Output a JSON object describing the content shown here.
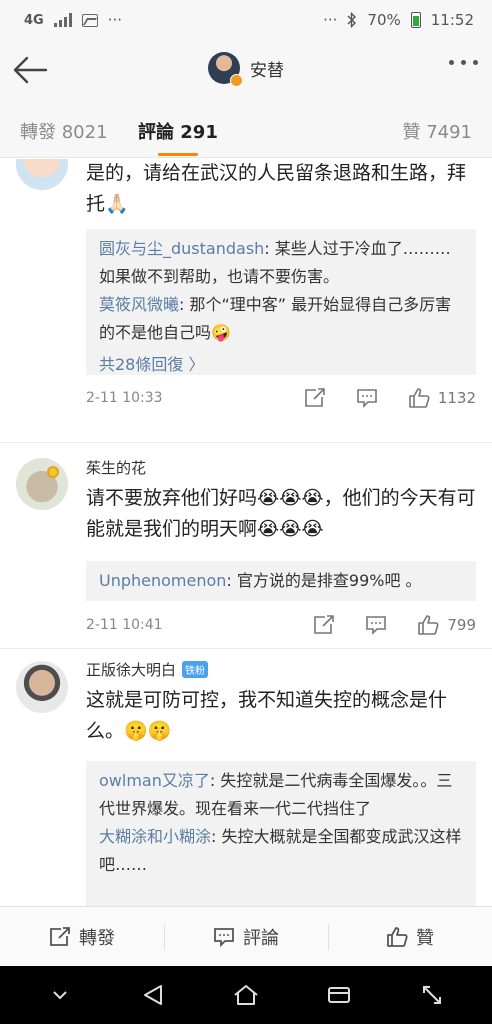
{
  "status_bar": {
    "network": "4G",
    "dots_left": "···",
    "dots_right": "···",
    "battery": "70%",
    "time": "11:52"
  },
  "header": {
    "user_name": "安替"
  },
  "tabs": {
    "repost": "轉發 8021",
    "comment": "評論 291",
    "like": "贊 7491"
  },
  "comments": [
    {
      "text": "是的，请给在武汉的人民留条退路和生路，拜托🙏🏻",
      "replies": [
        {
          "author": "圆灰与尘_dustandash",
          "text": ": 某些人过于冷血了………如果做不到帮助，也请不要伤害。"
        },
        {
          "author": "莫筱风微曦",
          "text": ": 那个“理中客” 最开始显得自己多厉害的不是他自己吗🤪"
        }
      ],
      "more_replies": "共28條回復 〉",
      "time": "2-11 10:33",
      "likes": "1132"
    },
    {
      "name": "茱生的花",
      "text": "请不要放弃他们好吗😭😭😭，他们的今天有可能就是我们的明天啊😭😭😭",
      "replies": [
        {
          "author": "Unphenomenon",
          "text": ": 官方说的是排查99%吧 。"
        }
      ],
      "time": "2-11 10:41",
      "likes": "799"
    },
    {
      "name": "正版徐大明白",
      "badge": "铁粉",
      "text": "这就是可防可控，我不知道失控的概念是什么。🤫🤫",
      "replies": [
        {
          "author": "owlman又凉了",
          "text": ": 失控就是二代病毒全国爆发。。三代世界爆发。现在看来一代二代挡住了"
        },
        {
          "author": "大糊涂和小糊涂",
          "text": ": 失控大概就是全国都变成武汉这样吧……"
        }
      ]
    }
  ],
  "action_bar": {
    "repost": "轉發",
    "comment": "評論",
    "like": "贊"
  },
  "colors": {
    "accent": "#ff8200",
    "link": "#5a7ea3",
    "fan_badge": "#4aa1ee"
  }
}
